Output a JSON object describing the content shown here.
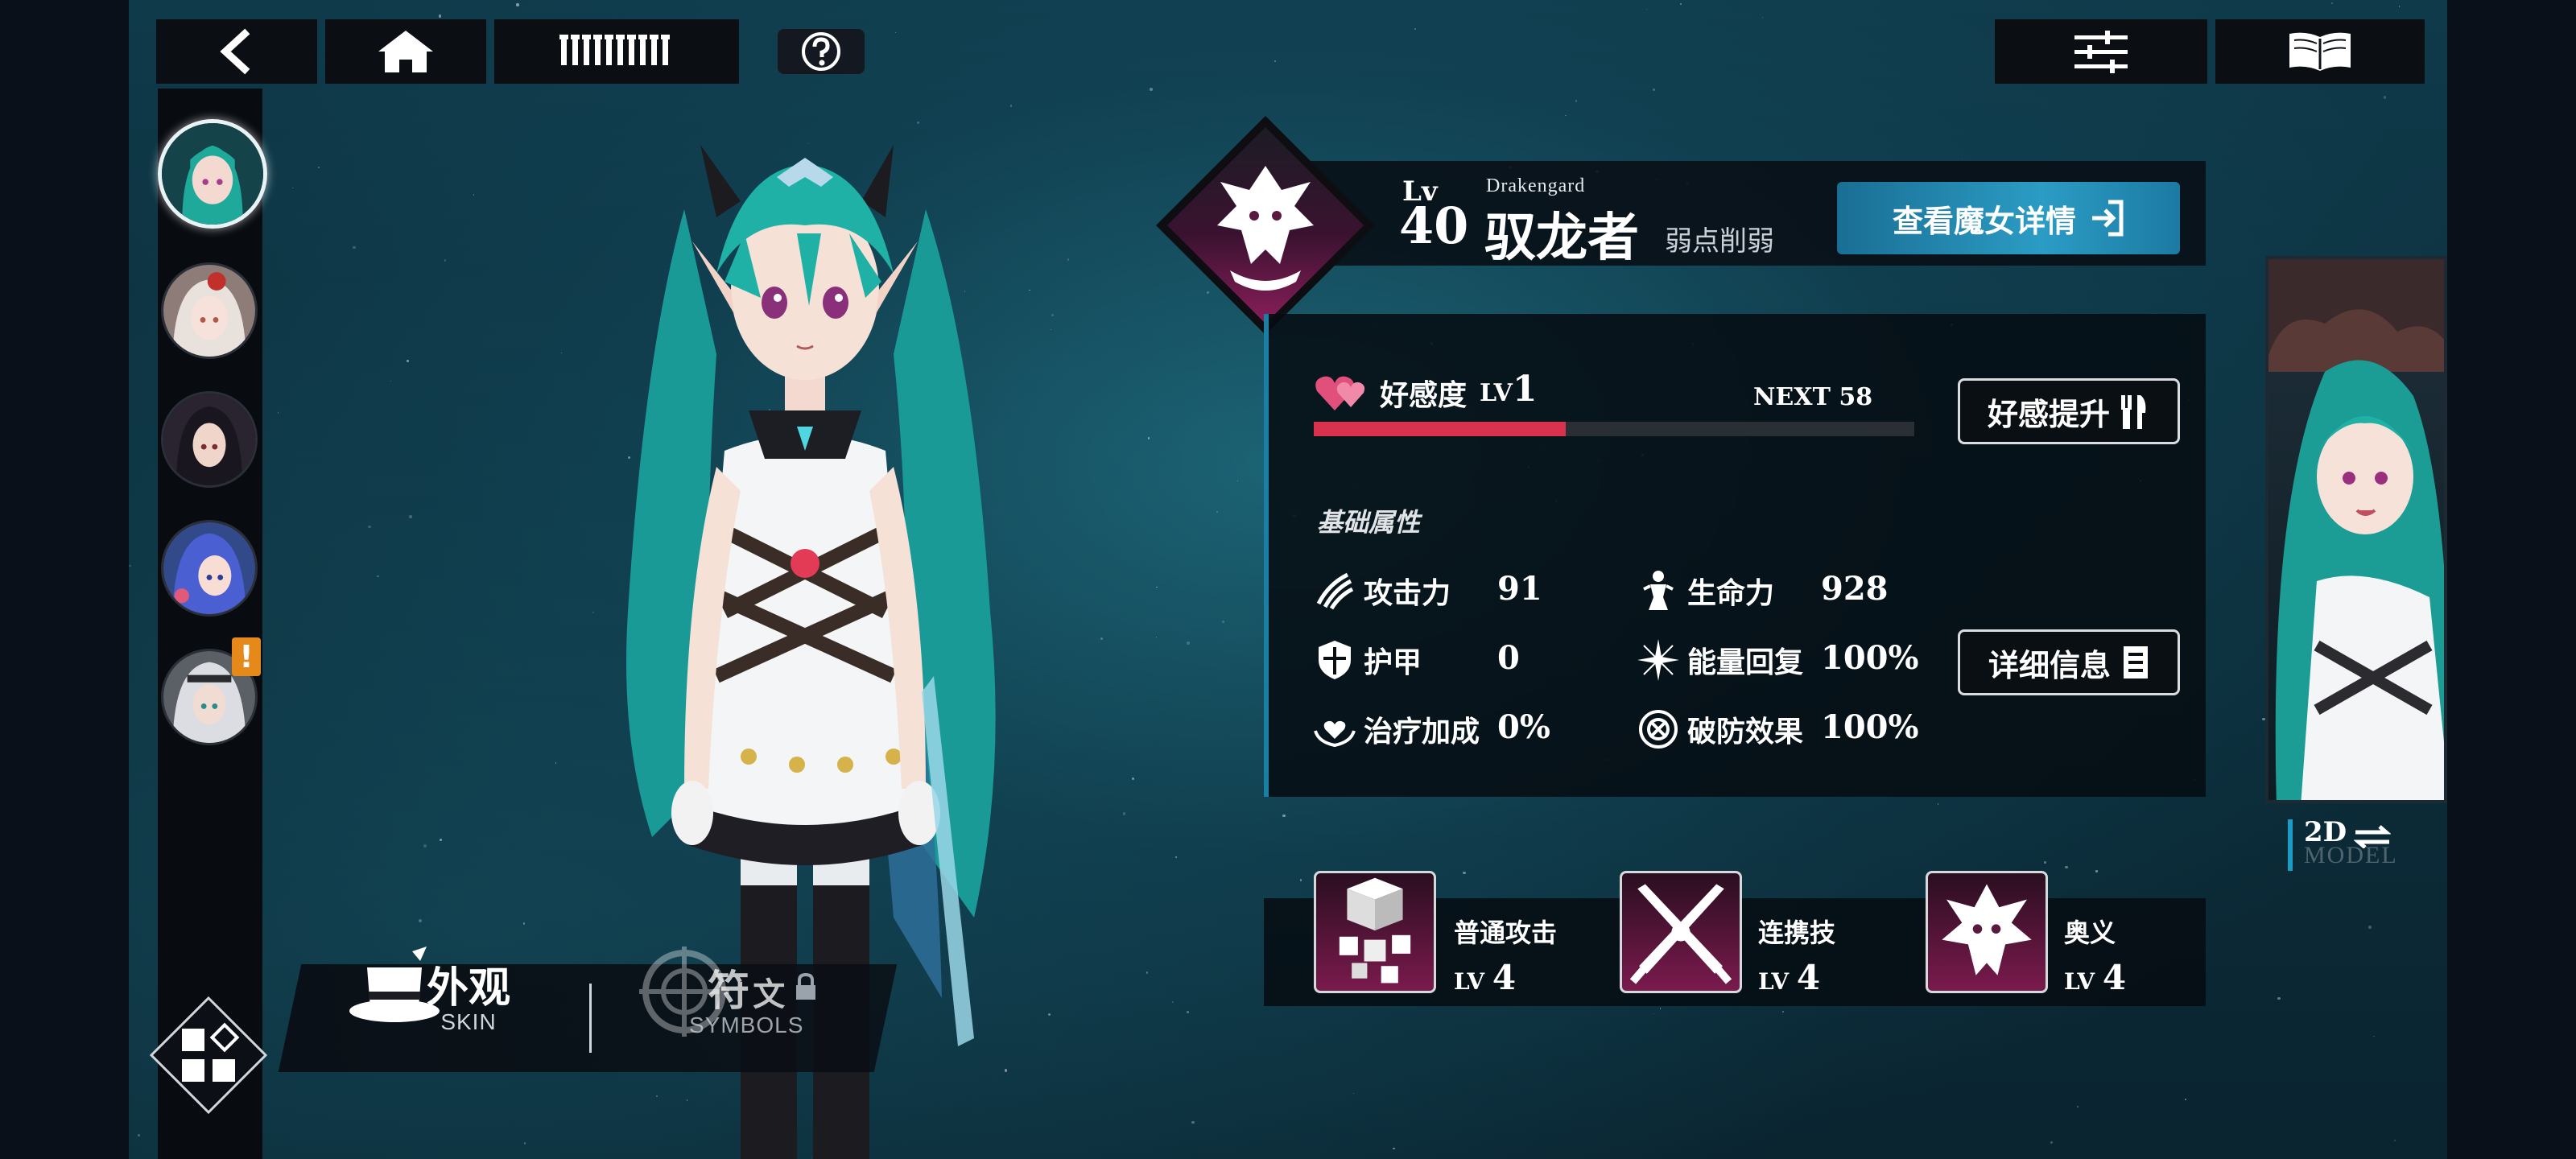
{
  "topbar": {
    "back_icon": "back-arrow-icon",
    "home_icon": "home-icon",
    "roster_icon": "roster-bars-icon",
    "help_icon": "help-icon",
    "settings_icon": "sliders-icon",
    "codex_icon": "book-icon"
  },
  "roster": {
    "avatars": [
      {
        "name": "witch-avatar-1",
        "selected": true
      },
      {
        "name": "witch-avatar-2",
        "selected": false
      },
      {
        "name": "witch-avatar-3",
        "selected": false
      },
      {
        "name": "witch-avatar-4",
        "selected": false
      },
      {
        "name": "witch-avatar-5",
        "selected": false,
        "alert": "!"
      }
    ]
  },
  "bottom_tabs": {
    "skin_label": "外观",
    "skin_sub": "SKIN",
    "symbols_label": "符",
    "symbols_label_small": "文",
    "symbols_sub": "SYMBOLS",
    "symbols_locked": true
  },
  "character": {
    "level_label": "Lv",
    "level": "40",
    "class_en": "Drakengard",
    "name": "驭龙者",
    "description": "弱点削弱",
    "detail_button": "查看魔女详情"
  },
  "affection": {
    "label": "好感度",
    "level_prefix": "LV",
    "level": "1",
    "next": "NEXT 58",
    "progress": 0.42,
    "button": "好感提升"
  },
  "base_stats": {
    "title": "基础属性",
    "items": [
      {
        "key": "attack",
        "name": "攻击力",
        "value": "91",
        "icon": "claw-icon"
      },
      {
        "key": "hp",
        "name": "生命力",
        "value": "928",
        "icon": "body-icon"
      },
      {
        "key": "armor",
        "name": "护甲",
        "value": "0",
        "icon": "shield-icon"
      },
      {
        "key": "energy",
        "name": "能量回复",
        "value": "100%",
        "icon": "sparkle-icon"
      },
      {
        "key": "heal",
        "name": "治疗加成",
        "value": "0%",
        "icon": "heart-hands-icon"
      },
      {
        "key": "break",
        "name": "破防效果",
        "value": "100%",
        "icon": "target-icon"
      }
    ],
    "detail_button": "详细信息"
  },
  "skills": [
    {
      "name": "普通攻击",
      "level_prefix": "LV",
      "level": "4",
      "icon": "cubes-icon"
    },
    {
      "name": "连携技",
      "level_prefix": "LV",
      "level": "4",
      "icon": "crossed-swords-icon"
    },
    {
      "name": "奥义",
      "level_prefix": "LV",
      "level": "4",
      "icon": "dragon-head-icon"
    }
  ],
  "model_toggle": {
    "label": "2D",
    "sub": "MODEL"
  },
  "colors": {
    "accent_blue": "#1a7fa2",
    "affection_red": "#d8324e",
    "alert_orange": "#e58a1a",
    "skill_magenta": "#7a1a4d"
  }
}
